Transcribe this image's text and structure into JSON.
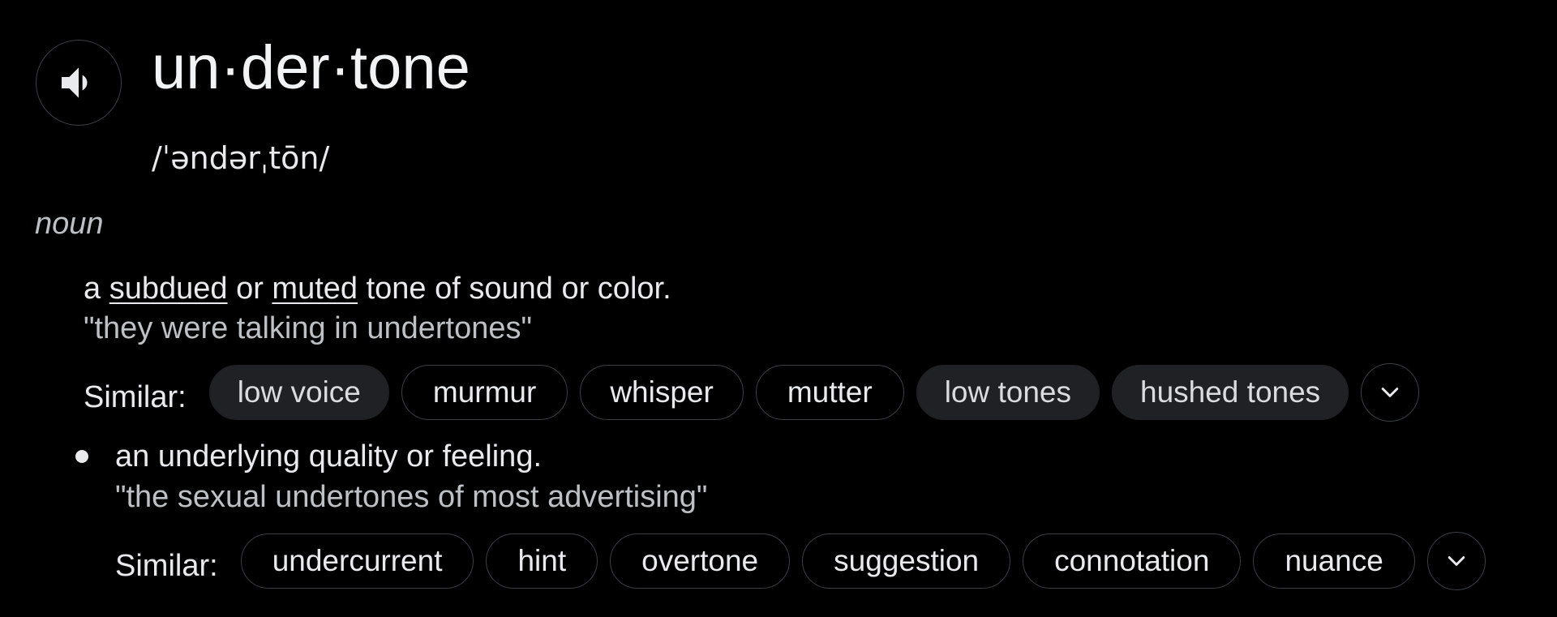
{
  "entry": {
    "headword": "un·der·tone",
    "phonetic": "/ˈəndərˌtōn/",
    "part_of_speech": "noun"
  },
  "senses": [
    {
      "definition": {
        "before": "a ",
        "link1": "subdued",
        "middle": " or ",
        "link2": "muted",
        "after": " tone of sound or color."
      },
      "example": "\"they were talking in undertones\"",
      "similar_label": "Similar:",
      "similar": [
        "low voice",
        "murmur",
        "whisper",
        "mutter",
        "low tones",
        "hushed tones"
      ]
    },
    {
      "definition": "an underlying quality or feeling.",
      "example": "\"the sexual undertones of most advertising\"",
      "similar_label": "Similar:",
      "similar": [
        "undercurrent",
        "hint",
        "overtone",
        "suggestion",
        "connotation",
        "nuance"
      ]
    }
  ],
  "icons": {
    "speaker": "speaker-icon",
    "expand": "chevron-down-icon"
  },
  "colors": {
    "background": "#000000",
    "text": "#e8eaed",
    "muted_text": "#bdc1c6",
    "chip_border": "#3c4043",
    "chip_filled": "#202124"
  }
}
